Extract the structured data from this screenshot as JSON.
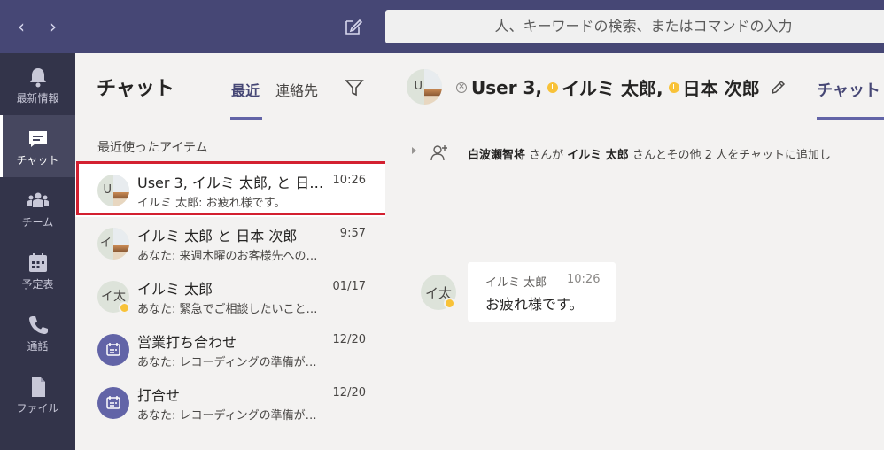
{
  "topbar": {
    "search_placeholder": "人、キーワードの検索、またはコマンドの入力"
  },
  "rail": {
    "items": [
      {
        "label": "最新情報",
        "icon": "bell-icon"
      },
      {
        "label": "チャット",
        "icon": "chat-icon",
        "active": true
      },
      {
        "label": "チーム",
        "icon": "teams-icon"
      },
      {
        "label": "予定表",
        "icon": "calendar-icon"
      },
      {
        "label": "通話",
        "icon": "phone-icon"
      },
      {
        "label": "ファイル",
        "icon": "file-icon"
      }
    ]
  },
  "list": {
    "title": "チャット",
    "tab_recent": "最近",
    "tab_contacts": "連絡先",
    "section_label": "最近使ったアイテム",
    "items": [
      {
        "name": "User 3, イルミ 太郎, と 日…",
        "time": "10:26",
        "preview": "イルミ 太郎: お疲れ様です。",
        "avatar_letter": "U",
        "selected": true
      },
      {
        "name": "イルミ 太郎 と 日本 次郎",
        "time": "9:57",
        "preview": "あなた: 来週木曜のお客様先への…",
        "avatar_letter": "イ"
      },
      {
        "name": "イルミ 太郎",
        "time": "01/17",
        "preview": "あなた: 緊急でご相談したいこと…",
        "avatar_initials": "イ太"
      },
      {
        "name": "営業打ち合わせ",
        "time": "12/20",
        "preview": "あなた: レコーディングの準備が…"
      },
      {
        "name": "打合せ",
        "time": "12/20",
        "preview": "あなた: レコーディングの準備が…"
      }
    ]
  },
  "main": {
    "header": {
      "avatar_letter": "U",
      "participants": [
        "User 3,",
        "イルミ 太郎,",
        "日本 次郎"
      ],
      "tab_label": "チャット"
    },
    "system": {
      "actor": "白波瀬智将",
      "part1": " さんが ",
      "target": "イルミ 太郎",
      "part2": " さんとその他 2 人をチャットに追加し"
    },
    "message": {
      "avatar_initials": "イ太",
      "author": "イルミ 太郎",
      "time": "10:26",
      "text": "お疲れ様です。"
    }
  },
  "colors": {
    "accent": "#6264a7",
    "topbar": "#464775",
    "rail": "#33344a",
    "away": "#f8c238",
    "highlight": "#d32030"
  }
}
